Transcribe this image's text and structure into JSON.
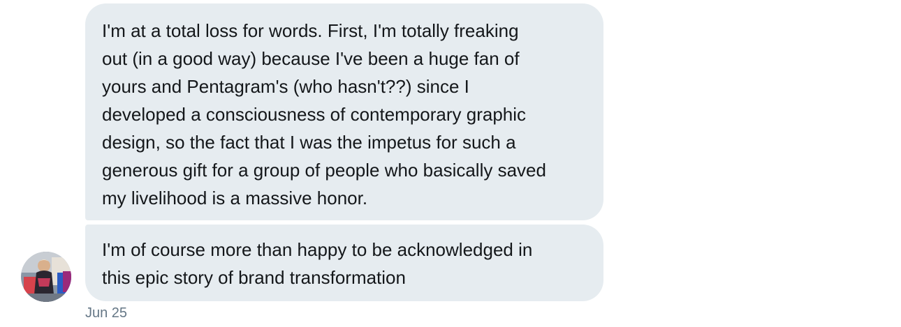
{
  "messages": [
    {
      "text": "I'm at a total loss for words. First, I'm totally freaking\nout (in a good way) because I've been a huge fan of\nyours and Pentagram's (who hasn't??) since I\ndeveloped a consciousness of contemporary graphic\ndesign, so the fact that I was the impetus for such a\ngenerous gift for a group of people who basically saved\nmy livelihood is a massive honor."
    },
    {
      "text": "I'm of course more than happy to be acknowledged in\nthis epic story of brand transformation"
    }
  ],
  "timestamp": "Jun 25",
  "colors": {
    "bubble_bg": "#e6ecf0",
    "text": "#14171a",
    "timestamp": "#657786"
  },
  "icons": {
    "avatar": "sender-avatar-photo"
  }
}
